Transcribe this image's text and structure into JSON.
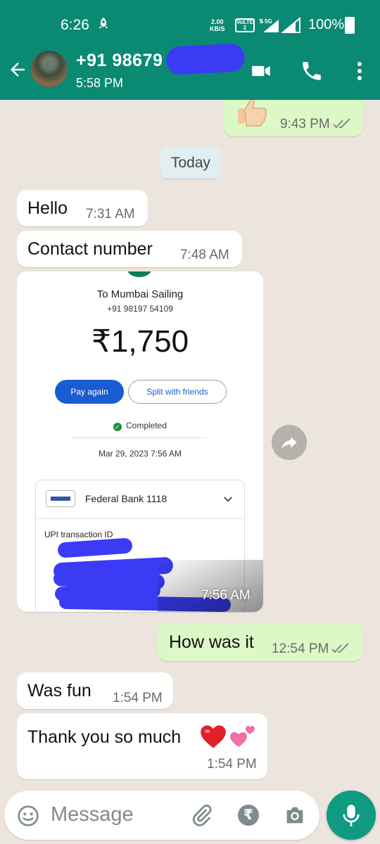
{
  "status_bar": {
    "time": "6:26",
    "net_speed_value": "2.00",
    "net_speed_unit": "KB/S",
    "network_label": "5G",
    "volte_label": "VoLTE 2",
    "battery": "100%"
  },
  "header": {
    "contact_name": "+91 98679",
    "last_seen": "5:58 PM"
  },
  "messages": {
    "m0_time": "9:43 PM",
    "date_chip": "Today",
    "m1_text": "Hello",
    "m1_time": "7:31 AM",
    "m2_text": "Contact number",
    "m2_time": "7:48 AM",
    "m3_time": "7:56 AM",
    "m4_text": "How was it",
    "m4_time": "12:54 PM",
    "m5_text": "Was fun",
    "m5_time": "1:54 PM",
    "m6_text": "Thank you so much",
    "m6_time": "1:54 PM"
  },
  "payment": {
    "to": "To Mumbai Sailing",
    "phone": "+91 98197 54109",
    "amount": "₹1,750",
    "pay_again": "Pay again",
    "split": "Split with friends",
    "status": "Completed",
    "datetime": "Mar 29, 2023 7:56 AM",
    "bank": "Federal Bank 1118",
    "upi_label": "UPI transaction ID"
  },
  "composer": {
    "placeholder": "Message",
    "rupee_symbol": "₹"
  },
  "colors": {
    "header": "#0b8a73",
    "outgoing": "#dcf8c6",
    "incoming": "#ffffff",
    "background": "#ece5dd",
    "mic": "#0f9b82"
  }
}
